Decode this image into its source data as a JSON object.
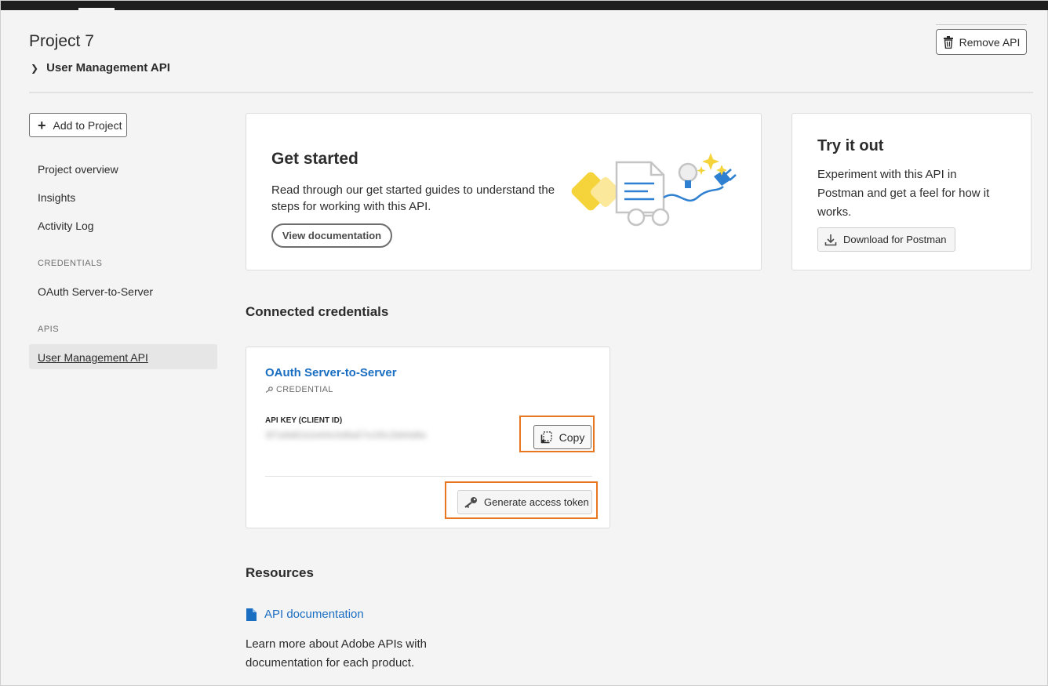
{
  "header": {
    "project_title": "Project 7",
    "breadcrumb_label": "User Management API",
    "remove_api_label": "Remove API"
  },
  "sidebar": {
    "add_to_project_label": "Add to Project",
    "items": [
      {
        "label": "Project overview"
      },
      {
        "label": "Insights"
      },
      {
        "label": "Activity Log"
      }
    ],
    "credentials_section": "CREDENTIALS",
    "credentials_items": [
      {
        "label": "OAuth Server-to-Server"
      }
    ],
    "apis_section": "APIS",
    "apis_items": [
      {
        "label": "User Management API",
        "active": true
      }
    ]
  },
  "get_started": {
    "title": "Get started",
    "description": "Read through our get started guides to understand the steps for working with this API.",
    "button_label": "View documentation"
  },
  "try_it": {
    "title": "Try it out",
    "description": "Experiment with this API in Postman and get a feel for how it works.",
    "button_label": "Download for Postman"
  },
  "connected_credentials": {
    "heading": "Connected credentials",
    "credential": {
      "title": "OAuth Server-to-Server",
      "type_label": "CREDENTIAL",
      "api_key_label": "API KEY (CLIENT ID)",
      "api_key_value": "3f7a9d81b2e64c0d9a57e1f0c2b84d6e",
      "copy_label": "Copy",
      "generate_token_label": "Generate access token"
    }
  },
  "resources": {
    "heading": "Resources",
    "link_label": "API documentation",
    "description": "Learn more about Adobe APIs with documentation for each product."
  },
  "colors": {
    "link_blue": "#1a6ec2",
    "highlight_orange": "#e87722",
    "illustration_yellow": "#f5d33b",
    "illustration_blue": "#2f80d1"
  }
}
